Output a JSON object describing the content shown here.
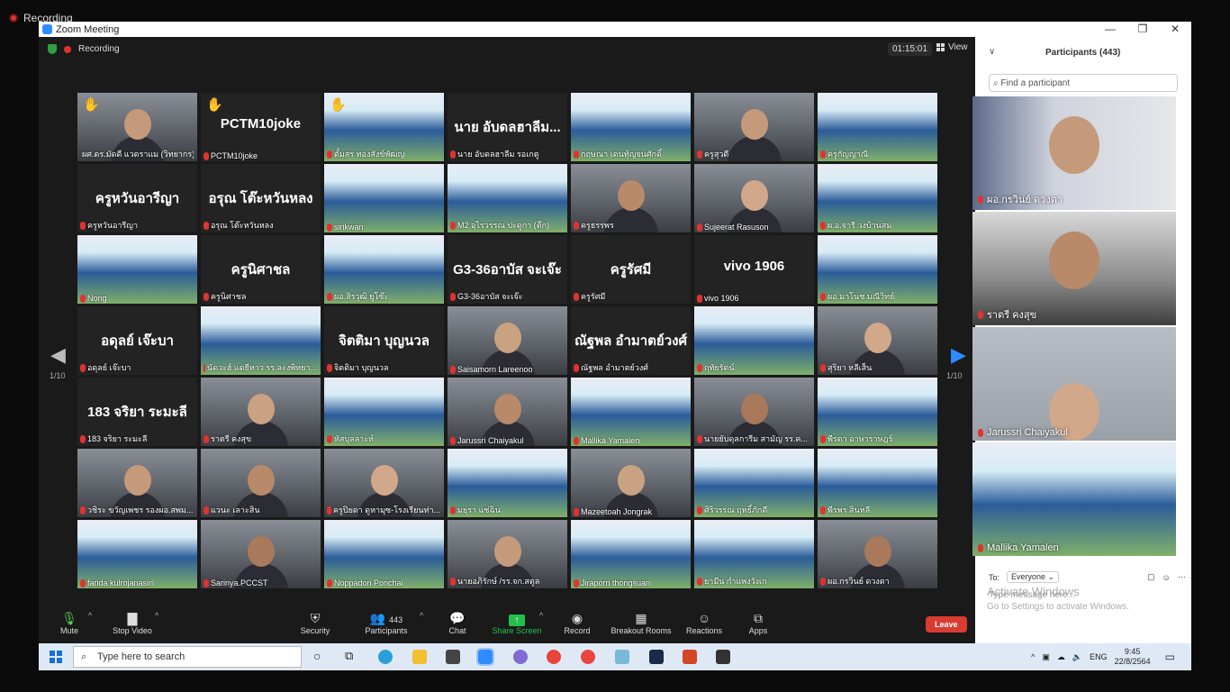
{
  "recording_indicator": "Recording",
  "window": {
    "title": "Zoom Meeting",
    "controls": [
      "—",
      "❐",
      "✕"
    ]
  },
  "meeting": {
    "recording_label": "Recording",
    "timer": "01:15:01",
    "view_label": "View",
    "page_left": "1/10",
    "page_right": "1/10"
  },
  "tiles": [
    {
      "name": "ผศ.ดร.มัดดี แวดราแม (วิทยากร)",
      "kind": "video",
      "active": true,
      "hand": true
    },
    {
      "name": "PCTM10joke",
      "kind": "text",
      "big": "PCTM10joke",
      "hand": true
    },
    {
      "name": "ตั้มสร ทองสังข์พัฒญ",
      "kind": "video",
      "hand": true
    },
    {
      "name": "นาย อับดลฮาลีม รอเกตู",
      "kind": "text",
      "big": "นาย อับดลฮาลีม..."
    },
    {
      "name": "กฤษณา เดนทุ้ญจนศักดิ์",
      "kind": "video"
    },
    {
      "name": "ครูสุวดี",
      "kind": "video"
    },
    {
      "name": "ครูกัญญาณี",
      "kind": "video"
    },
    {
      "name": "ครูหวันอารีญา",
      "kind": "text",
      "big": "ครูหวันอารีญา"
    },
    {
      "name": "อรุณ โต๊ะหวันหลง",
      "kind": "text",
      "big": "อรุณ โต๊ะหวันหลง"
    },
    {
      "name": "sirikwan",
      "kind": "video"
    },
    {
      "name": "M2 อุไรวรรณ ปะดูกา (ตึก)",
      "kind": "video"
    },
    {
      "name": "ครูธรรพร",
      "kind": "video"
    },
    {
      "name": "Sujeerat Rasuson",
      "kind": "video"
    },
    {
      "name": "ผ.อ.จารี วงบ้านสม",
      "kind": "video"
    },
    {
      "name": "Nong",
      "kind": "video"
    },
    {
      "name": "ครูนิศาชล",
      "kind": "text",
      "big": "ครูนิศาชล"
    },
    {
      "name": "ผอ.สิรวุฒิ ยูโซ๊ะ",
      "kind": "video"
    },
    {
      "name": "G3-36อาบัส จะเจ๊ะ",
      "kind": "text",
      "big": "G3-36อาบัส จะเจ๊ะ"
    },
    {
      "name": "ครูรัศมี",
      "kind": "text",
      "big": "ครูรัศมี"
    },
    {
      "name": "vivo 1906",
      "kind": "text",
      "big": "vivo 1906"
    },
    {
      "name": "ผอ.มาโนช มณีวิทย์",
      "kind": "video"
    },
    {
      "name": "อดุลย์ เจ๊ะบา",
      "kind": "text",
      "big": "อดุลย์ เจ๊ะบา"
    },
    {
      "name": "นัดวะฮ์ แดยีหาว รร.ละงพิทยา...",
      "kind": "video"
    },
    {
      "name": "จิตติมา บุญนวล",
      "kind": "text",
      "big": "จิตติมา บุญนวล"
    },
    {
      "name": "Saisamorn Lareenoo",
      "kind": "video"
    },
    {
      "name": "ณัฐพล อำมาตย์วงศ์",
      "kind": "text",
      "big": "ณัฐพล อำมาตย์วงศ์"
    },
    {
      "name": "ฤทัยรัตน์",
      "kind": "video"
    },
    {
      "name": "สุริยา หลีเส็น",
      "kind": "video"
    },
    {
      "name": "183 จริยา ระมะลี",
      "kind": "text",
      "big": "183 จริยา ระมะลี"
    },
    {
      "name": "ราตรี คงสุข",
      "kind": "video"
    },
    {
      "name": "หัสบุลลาะห์",
      "kind": "video"
    },
    {
      "name": "Jarussri Chaiyakul",
      "kind": "video"
    },
    {
      "name": "Mallika Yamalen",
      "kind": "video"
    },
    {
      "name": "นายยับดุลการีม สามัญ รร.ค...",
      "kind": "video"
    },
    {
      "name": "พีรดา อาษาราษฎร์",
      "kind": "video"
    },
    {
      "name": "วชิระ ขวัญเพชร รองผอ.สพม...",
      "kind": "video"
    },
    {
      "name": "แวนะ เลาะสิน",
      "kind": "video"
    },
    {
      "name": "ครูปิยดา ดูหามุซ-โรงเรียนท่า...",
      "kind": "video"
    },
    {
      "name": "มยุรา แซ่ฉิน",
      "kind": "video"
    },
    {
      "name": "Mazeetoah Jongrak",
      "kind": "video"
    },
    {
      "name": "ศิริวรรณ ฤทธิ์ภักดี",
      "kind": "video"
    },
    {
      "name": "พีรพร สินหลี",
      "kind": "video"
    },
    {
      "name": "farida kulrojanasiri",
      "kind": "video"
    },
    {
      "name": "Sarinya.PCCST",
      "kind": "video"
    },
    {
      "name": "Noppadon Ponchai",
      "kind": "video"
    },
    {
      "name": "นายอภิรักษ์ /รร.จก.สตูล",
      "kind": "video"
    },
    {
      "name": "Jiraporn thongsuan",
      "kind": "video"
    },
    {
      "name": "ยามีน กำแพงวังเก",
      "kind": "video"
    },
    {
      "name": "ผอ.กรวินย์ ดวงตา",
      "kind": "video"
    }
  ],
  "toolbar": {
    "mute": "Mute",
    "stop_video": "Stop Video",
    "security": "Security",
    "participants": "Participants",
    "participants_count": "443",
    "chat": "Chat",
    "share_screen": "Share Screen",
    "record": "Record",
    "breakout": "Breakout Rooms",
    "reactions": "Reactions",
    "apps": "Apps",
    "leave": "Leave"
  },
  "panel": {
    "title": "Participants (443)",
    "search_placeholder": "Find a participant",
    "videos": [
      {
        "name": "ผอ.กรวินย์ ดวงตา"
      },
      {
        "name": "ราตรี คงสุข"
      },
      {
        "name": "Jarussri Chaiyakul"
      },
      {
        "name": "Mallika Yamalen"
      }
    ],
    "to_label": "To:",
    "to_value": "Everyone",
    "message_placeholder": "Type message here...",
    "activate_title": "Activate Windows",
    "activate_sub": "Go to Settings to activate Windows."
  },
  "taskbar": {
    "search_placeholder": "Type here to search",
    "lang": "ENG",
    "time": "9:45",
    "date": "22/8/2564"
  },
  "colors": {
    "accent": "#2d8cff",
    "leave": "#d93b30",
    "share": "#23c14b",
    "active_border": "#d8e23a"
  }
}
